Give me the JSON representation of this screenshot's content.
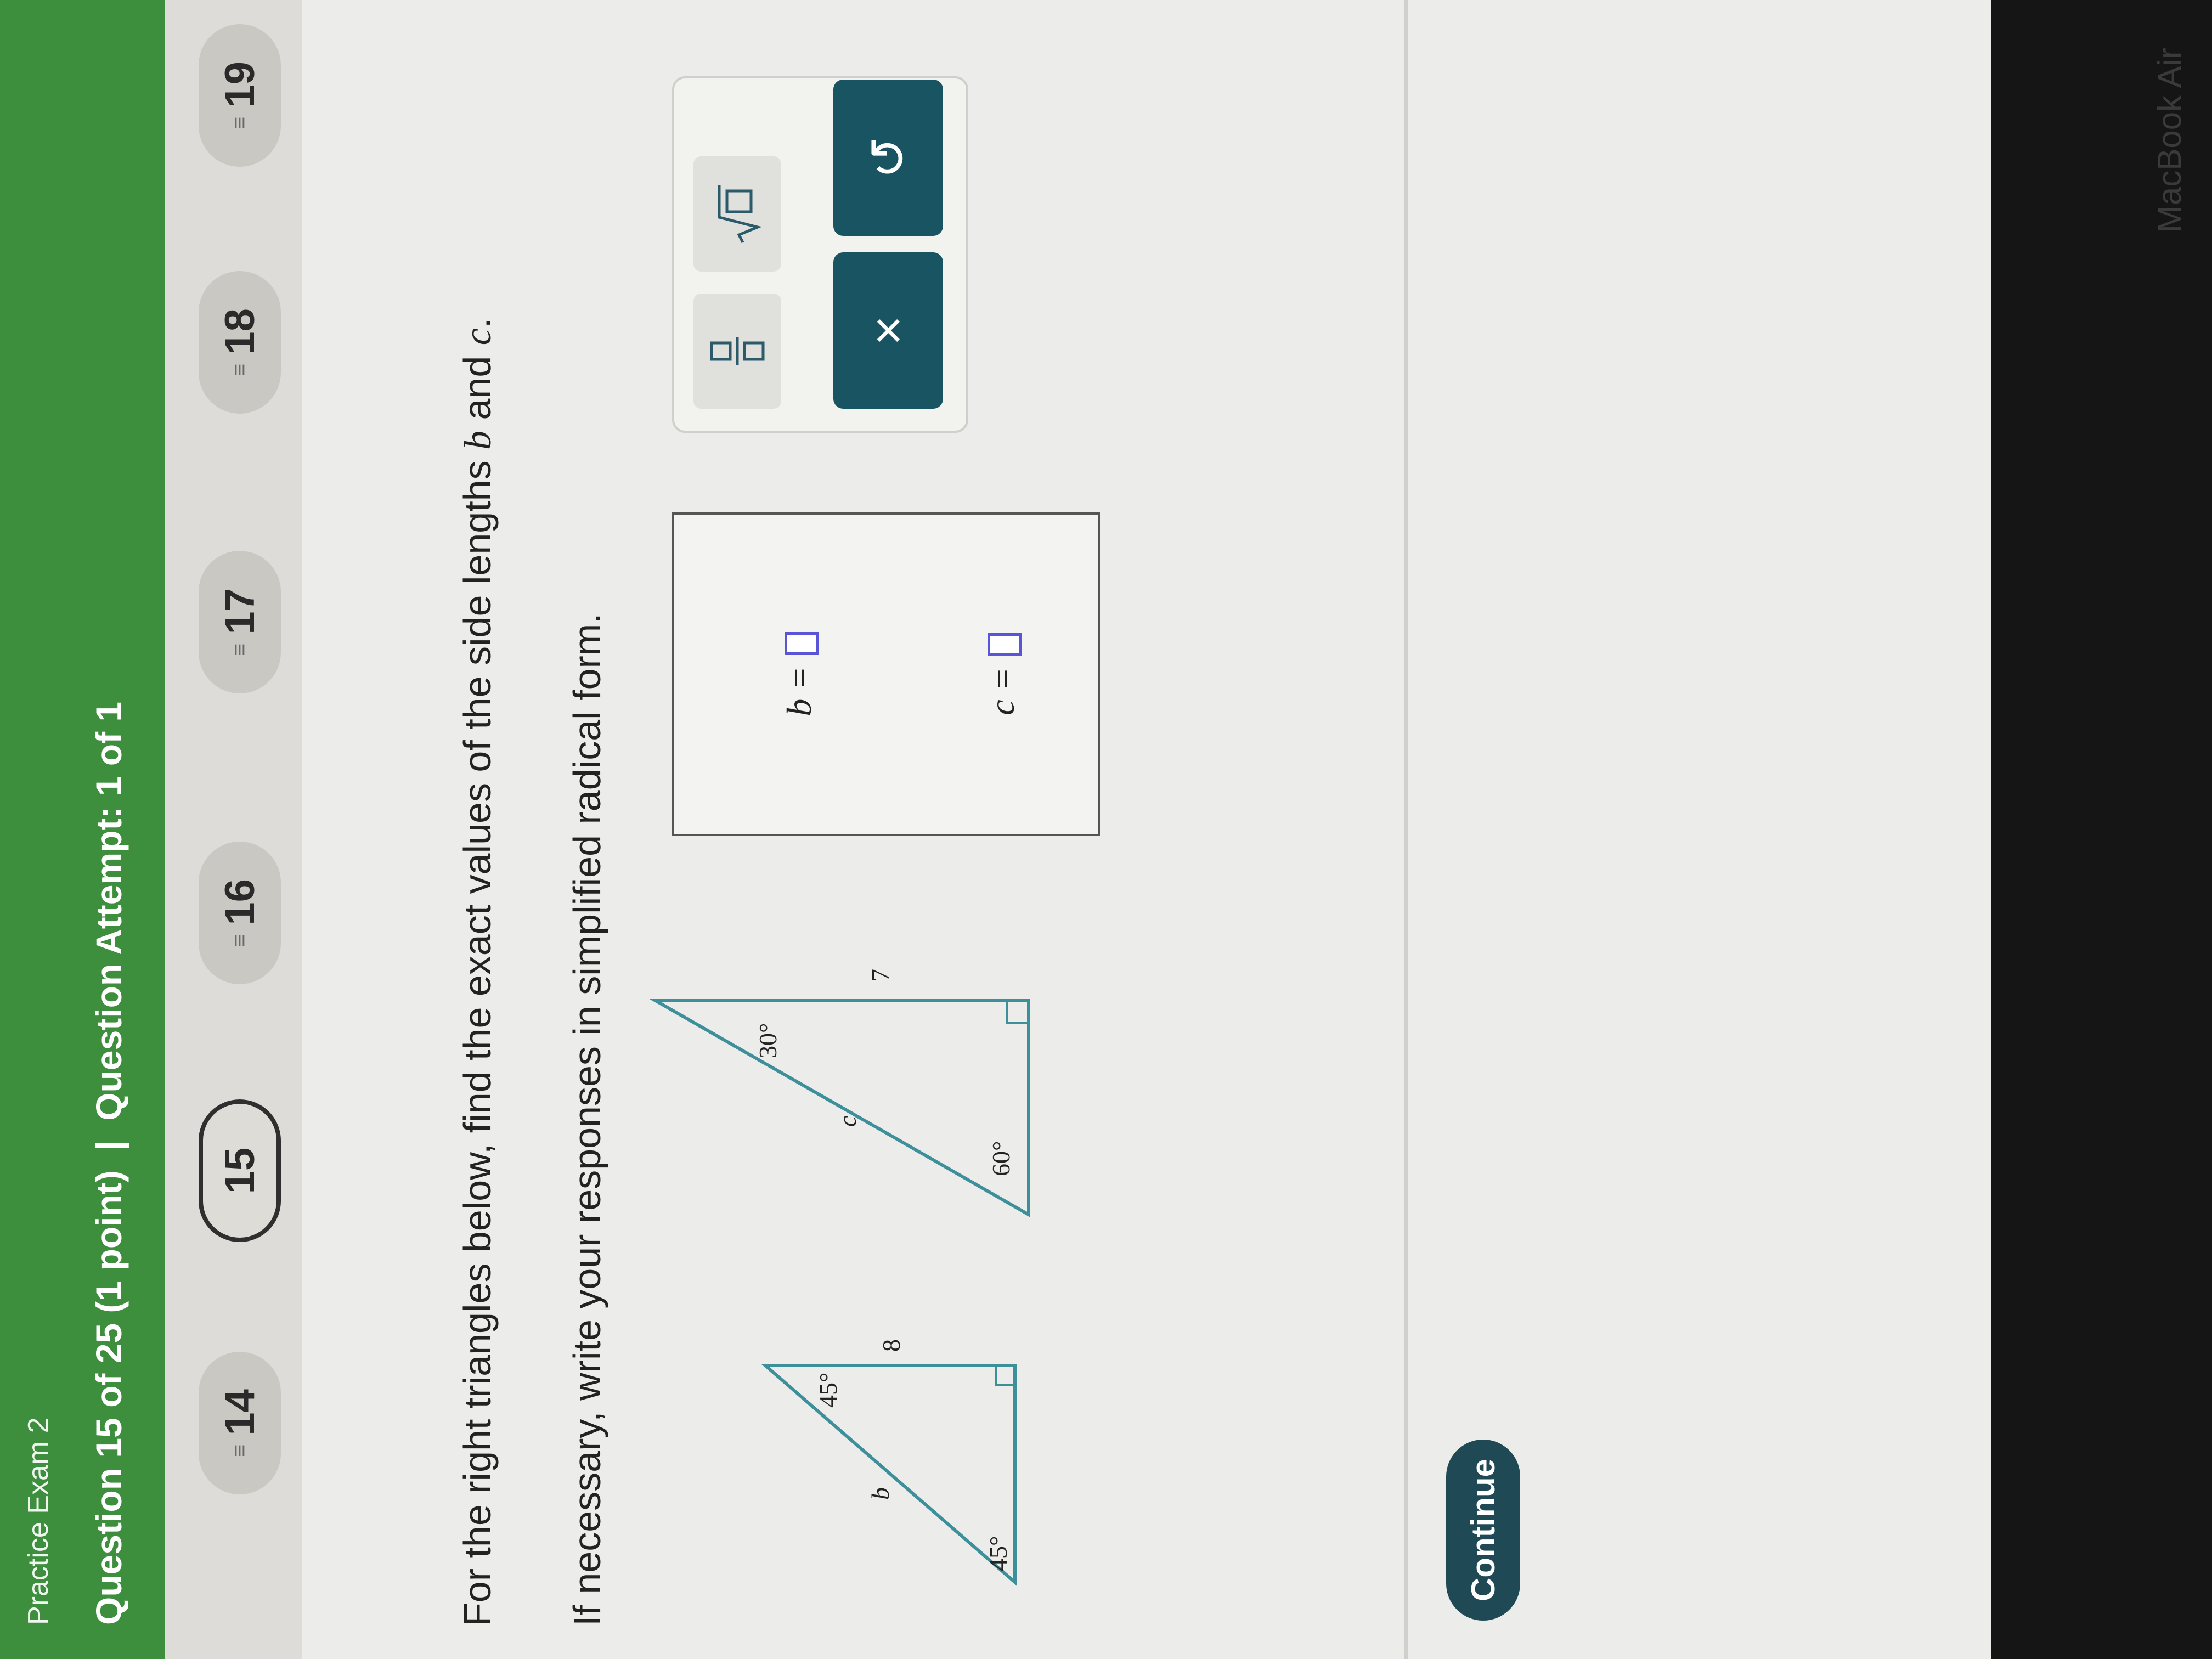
{
  "header": {
    "exam_title": "Practice Exam 2",
    "question_progress": "Question 15 of 25 (1 point)",
    "separator": "|",
    "attempt": "Question Attempt: 1 of 1"
  },
  "question_nav": {
    "items": [
      {
        "label": "14",
        "current": false
      },
      {
        "label": "15",
        "current": true
      },
      {
        "label": "16",
        "current": false
      },
      {
        "label": "17",
        "current": false
      },
      {
        "label": "18",
        "current": false
      },
      {
        "label": "19",
        "current": false
      }
    ],
    "marker_glyph": "≡"
  },
  "question": {
    "prompt_start": "For the right triangles below, find the exact values of the side lengths ",
    "var_b": "b",
    "prompt_and": " and ",
    "var_c": "c",
    "prompt_end": ".",
    "instruction": "If necessary, write your responses in simplified radical form."
  },
  "triangle_1": {
    "side_label": "b",
    "leg_label": "8",
    "angle_top": "45°",
    "angle_bottom": "45°"
  },
  "triangle_2": {
    "hyp_label": "c",
    "leg_label": "7",
    "angle_top": "30°",
    "angle_bottom": "60°"
  },
  "answers": {
    "b_label": "b =",
    "c_label": "c ="
  },
  "palette": {
    "fraction_icon": "fraction-icon",
    "sqrt_icon": "sqrt-icon",
    "clear_glyph": "×",
    "undo_glyph": "↺"
  },
  "footer": {
    "continue_label": "Continue"
  },
  "device_label": "MacBook Air"
}
